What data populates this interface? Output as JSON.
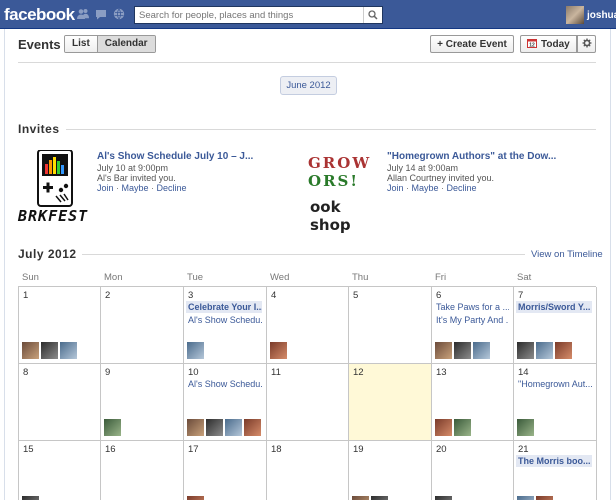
{
  "app": {
    "name": "facebook",
    "user_name": "joshua"
  },
  "search": {
    "placeholder": "Search for people, places and things"
  },
  "header": {
    "title": "Events",
    "view_list": "List",
    "view_calendar": "Calendar",
    "create_event": "+ Create Event",
    "today": "Today"
  },
  "month_selector": "June 2012",
  "invites": {
    "title": "Invites",
    "items": [
      {
        "title": "Al's Show Schedule July 10 – J...",
        "date": "July 10 at 9:00pm",
        "invited_by": "Al's Bar invited you.",
        "join": "Join",
        "maybe": "Maybe",
        "decline": "Decline"
      },
      {
        "title": "\"Homegrown Authors\" at the Dow...",
        "date": "July 14 at 9:00am",
        "invited_by": "Allan Courtney invited you.",
        "join": "Join",
        "maybe": "Maybe",
        "decline": "Decline"
      }
    ]
  },
  "calendar": {
    "title": "July 2012",
    "view_on_timeline": "View on Timeline",
    "days_of_week": [
      "Sun",
      "Mon",
      "Tue",
      "Wed",
      "Thu",
      "Fri",
      "Sat"
    ],
    "weeks": [
      [
        {
          "day": "1",
          "events": [],
          "thumbs": 3
        },
        {
          "day": "2",
          "events": [],
          "thumbs": 0
        },
        {
          "day": "3",
          "events": [
            {
              "label": "Celebrate Your I...",
              "highlight": true
            },
            {
              "label": "Al's Show Schedu...",
              "highlight": false
            }
          ],
          "thumbs": 1
        },
        {
          "day": "4",
          "events": [],
          "thumbs": 1
        },
        {
          "day": "5",
          "events": [],
          "thumbs": 0
        },
        {
          "day": "6",
          "events": [
            {
              "label": "Take Paws for a ...",
              "highlight": false
            },
            {
              "label": "It's My Party And ...",
              "highlight": false
            }
          ],
          "thumbs": 3
        },
        {
          "day": "7",
          "events": [
            {
              "label": "Morris/Sword Y...",
              "highlight": true
            }
          ],
          "thumbs": 3
        }
      ],
      [
        {
          "day": "8",
          "events": [],
          "thumbs": 0
        },
        {
          "day": "9",
          "events": [],
          "thumbs": 1
        },
        {
          "day": "10",
          "events": [
            {
              "label": "Al's Show Schedu...",
              "highlight": false
            }
          ],
          "thumbs": 4
        },
        {
          "day": "11",
          "events": [],
          "thumbs": 0
        },
        {
          "day": "12",
          "events": [],
          "thumbs": 0,
          "today": true
        },
        {
          "day": "13",
          "events": [],
          "thumbs": 2
        },
        {
          "day": "14",
          "events": [
            {
              "label": "\"Homegrown Aut...",
              "highlight": false
            }
          ],
          "thumbs": 1
        }
      ],
      [
        {
          "day": "15",
          "events": [],
          "thumbs": 1
        },
        {
          "day": "16",
          "events": [],
          "thumbs": 0
        },
        {
          "day": "17",
          "events": [],
          "thumbs": 1
        },
        {
          "day": "18",
          "events": [],
          "thumbs": 0
        },
        {
          "day": "19",
          "events": [],
          "thumbs": 2
        },
        {
          "day": "20",
          "events": [],
          "thumbs": 1
        },
        {
          "day": "21",
          "events": [
            {
              "label": "The Morris boo...",
              "highlight": true
            }
          ],
          "thumbs": 2
        }
      ]
    ]
  },
  "colors": {
    "brand": "#3b5998",
    "link": "#3b5998",
    "today": "#fff9d7",
    "event_highlight": "#e3e8f3"
  },
  "poster_texts": {
    "brkfest": "BRKFEST",
    "homegrown_top": "GROW",
    "homegrown_mid": "ORS!",
    "homegrown_bottom": "ook shop"
  }
}
